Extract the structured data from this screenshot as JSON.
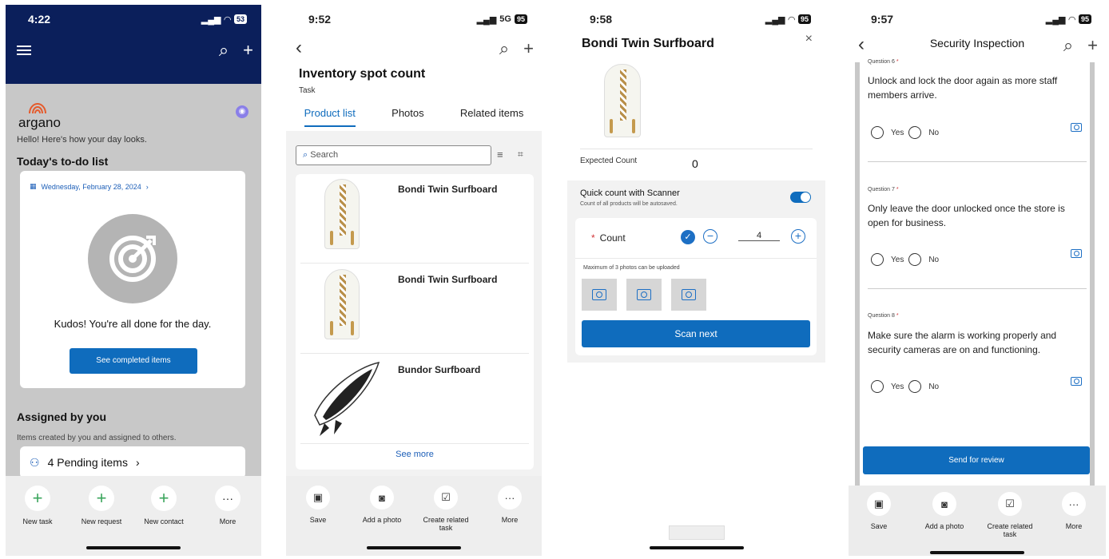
{
  "phone1": {
    "time": "4:22",
    "battery": "53",
    "logo_text": "argano",
    "greeting": "Hello! Here's how your day looks.",
    "todo_heading": "Today's to-do list",
    "date": "Wednesday, February 28, 2024",
    "kudos": "Kudos! You're all done for the day.",
    "see_completed": "See completed items",
    "assigned_heading": "Assigned by you",
    "assigned_sub": "Items created by you and assigned to others.",
    "pending": "4 Pending items",
    "bottom": [
      "New task",
      "New request",
      "New contact",
      "More"
    ]
  },
  "phone2": {
    "time": "9:52",
    "network": "5G",
    "battery": "95",
    "title": "Inventory spot count",
    "subtitle": "Task",
    "tabs": [
      "Product list",
      "Photos",
      "Related items"
    ],
    "search_placeholder": "Search",
    "products": [
      "Bondi Twin Surfboard",
      "Bondi Twin Surfboard",
      "Bundor Surfboard"
    ],
    "see_more": "See more",
    "bottom": [
      "Save",
      "Add a photo",
      "Create related task",
      "More"
    ]
  },
  "phone3": {
    "time": "9:58",
    "battery": "95",
    "title": "Bondi Twin Surfboard",
    "expected_label": "Expected Count",
    "expected_value": "0",
    "quick_count": "Quick count with Scanner",
    "quick_sub": "Count of all products will be autosaved.",
    "count_label": "Count",
    "count_value": "4",
    "max_photos": "Maximum of 3 photos can be uploaded",
    "scan_next": "Scan next"
  },
  "phone4": {
    "time": "9:57",
    "battery": "95",
    "title": "Security Inspection",
    "questions": [
      {
        "label": "Question 6",
        "text": "Unlock and lock the door again as more staff members arrive."
      },
      {
        "label": "Question 7",
        "text": "Only leave the door unlocked once the store is open for business."
      },
      {
        "label": "Question 8",
        "text": "Make sure the alarm is working properly and security cameras are on and functioning."
      }
    ],
    "yes": "Yes",
    "no": "No",
    "send": "Send for review",
    "bottom": [
      "Save",
      "Add a photo",
      "Create related task",
      "More"
    ]
  },
  "colors": {
    "navy": "#0b1f5b",
    "primary": "#0f6cbd",
    "green": "#3ba55c"
  }
}
